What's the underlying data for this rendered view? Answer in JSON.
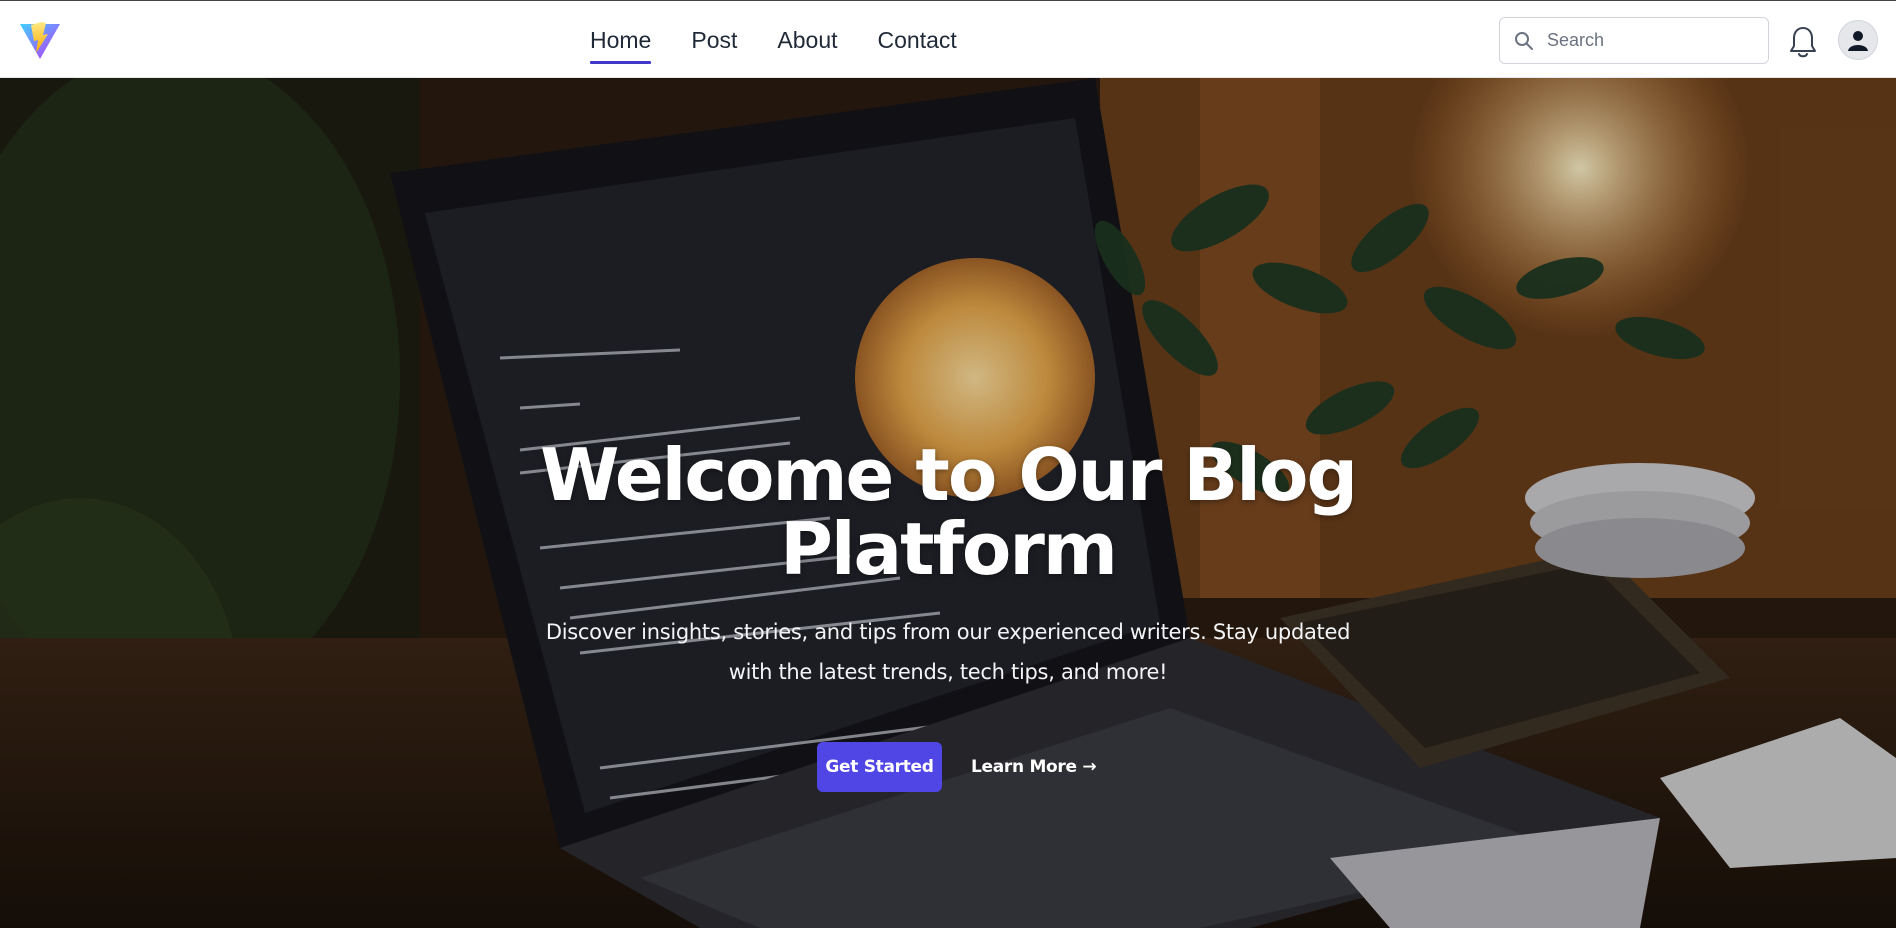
{
  "nav": {
    "links": [
      {
        "label": "Home",
        "active": true
      },
      {
        "label": "Post",
        "active": false
      },
      {
        "label": "About",
        "active": false
      },
      {
        "label": "Contact",
        "active": false
      }
    ],
    "search": {
      "placeholder": "Search",
      "value": ""
    },
    "icons": {
      "logo": "vite-logo-icon",
      "search": "search-icon",
      "notifications": "bell-icon",
      "profile": "user-icon"
    }
  },
  "hero": {
    "title_line1": "Welcome to Our Blog",
    "title_line2": "Platform",
    "subtitle": "Discover insights, stories, and tips from our experienced writers. Stay updated with the latest trends, tech tips, and more!",
    "primary_button": "Get Started",
    "secondary_button": "Learn More →"
  },
  "colors": {
    "accent": "#4f46e5",
    "active_underline": "#4338ca",
    "nav_text": "#1f2937",
    "hero_text": "#ffffff"
  }
}
